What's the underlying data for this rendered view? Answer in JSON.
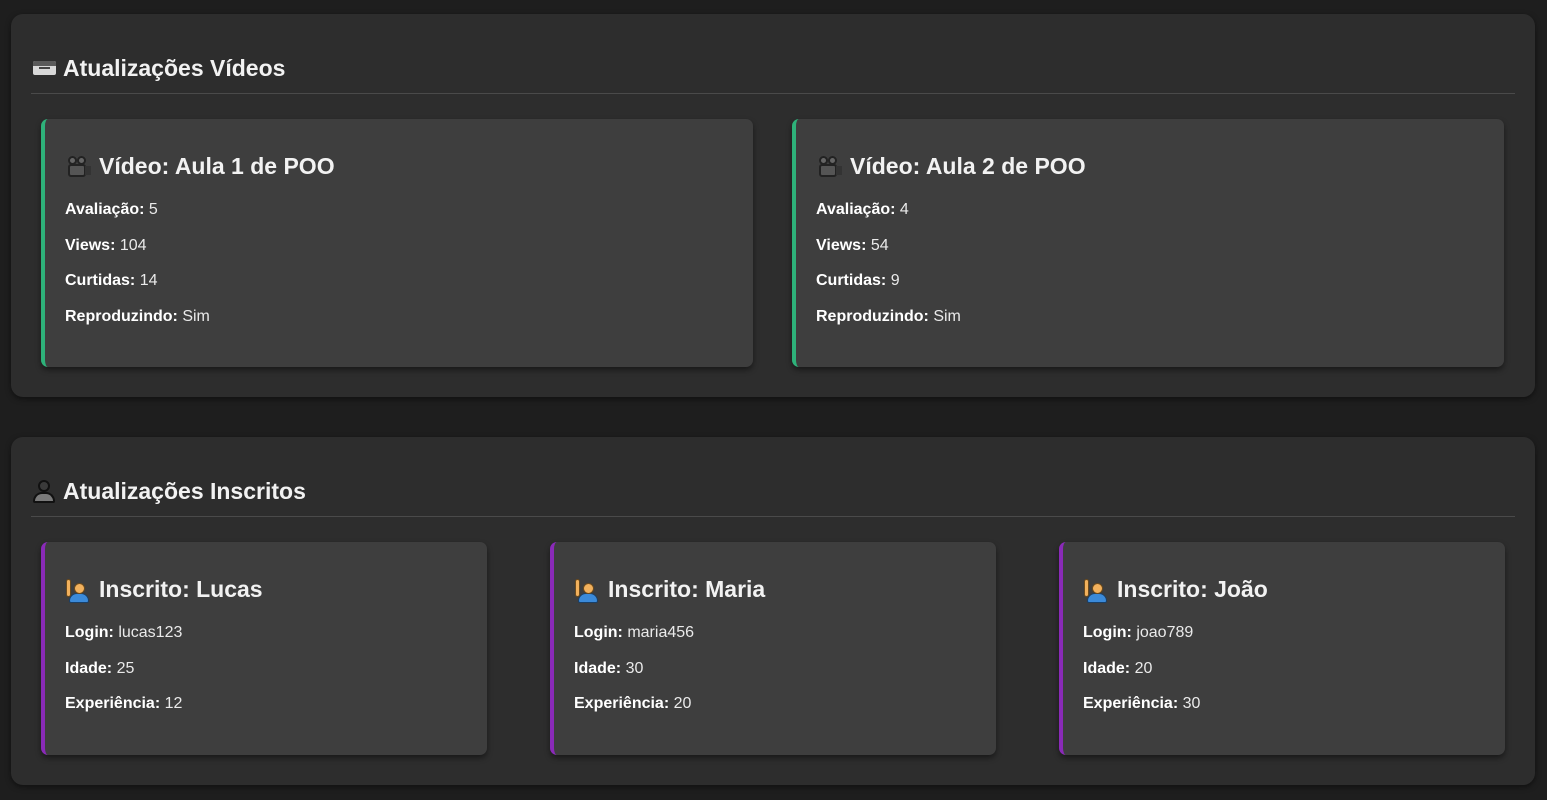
{
  "videos_section": {
    "icon": "card-file-box-icon",
    "title": "Atualizações Vídeos",
    "cards": [
      {
        "icon": "movie-camera-icon",
        "title": "Vídeo: Aula 1 de POO",
        "fields": [
          {
            "label": "Avaliação:",
            "value": "5"
          },
          {
            "label": "Views:",
            "value": "104"
          },
          {
            "label": "Curtidas:",
            "value": "14"
          },
          {
            "label": "Reproduzindo:",
            "value": "Sim"
          }
        ]
      },
      {
        "icon": "movie-camera-icon",
        "title": "Vídeo: Aula 2 de POO",
        "fields": [
          {
            "label": "Avaliação:",
            "value": "4"
          },
          {
            "label": "Views:",
            "value": "54"
          },
          {
            "label": "Curtidas:",
            "value": "9"
          },
          {
            "label": "Reproduzindo:",
            "value": "Sim"
          }
        ]
      }
    ]
  },
  "subscribers_section": {
    "icon": "user-silhouette-icon",
    "title": "Atualizações Inscritos",
    "cards": [
      {
        "icon": "person-raising-hand-icon",
        "title": "Inscrito: Lucas",
        "fields": [
          {
            "label": "Login:",
            "value": "lucas123"
          },
          {
            "label": "Idade:",
            "value": "25"
          },
          {
            "label": "Experiência:",
            "value": "12"
          }
        ]
      },
      {
        "icon": "person-raising-hand-icon",
        "title": "Inscrito: Maria",
        "fields": [
          {
            "label": "Login:",
            "value": "maria456"
          },
          {
            "label": "Idade:",
            "value": "30"
          },
          {
            "label": "Experiência:",
            "value": "20"
          }
        ]
      },
      {
        "icon": "person-raising-hand-icon",
        "title": "Inscrito: João",
        "fields": [
          {
            "label": "Login:",
            "value": "joao789"
          },
          {
            "label": "Idade:",
            "value": "20"
          },
          {
            "label": "Experiência:",
            "value": "30"
          }
        ]
      }
    ]
  },
  "colors": {
    "background": "#1e1e1e",
    "section_bg": "#2d2d2d",
    "card_bg": "#3e3e3e",
    "video_accent": "#2eb27a",
    "subscriber_accent": "#8a2ab8"
  }
}
